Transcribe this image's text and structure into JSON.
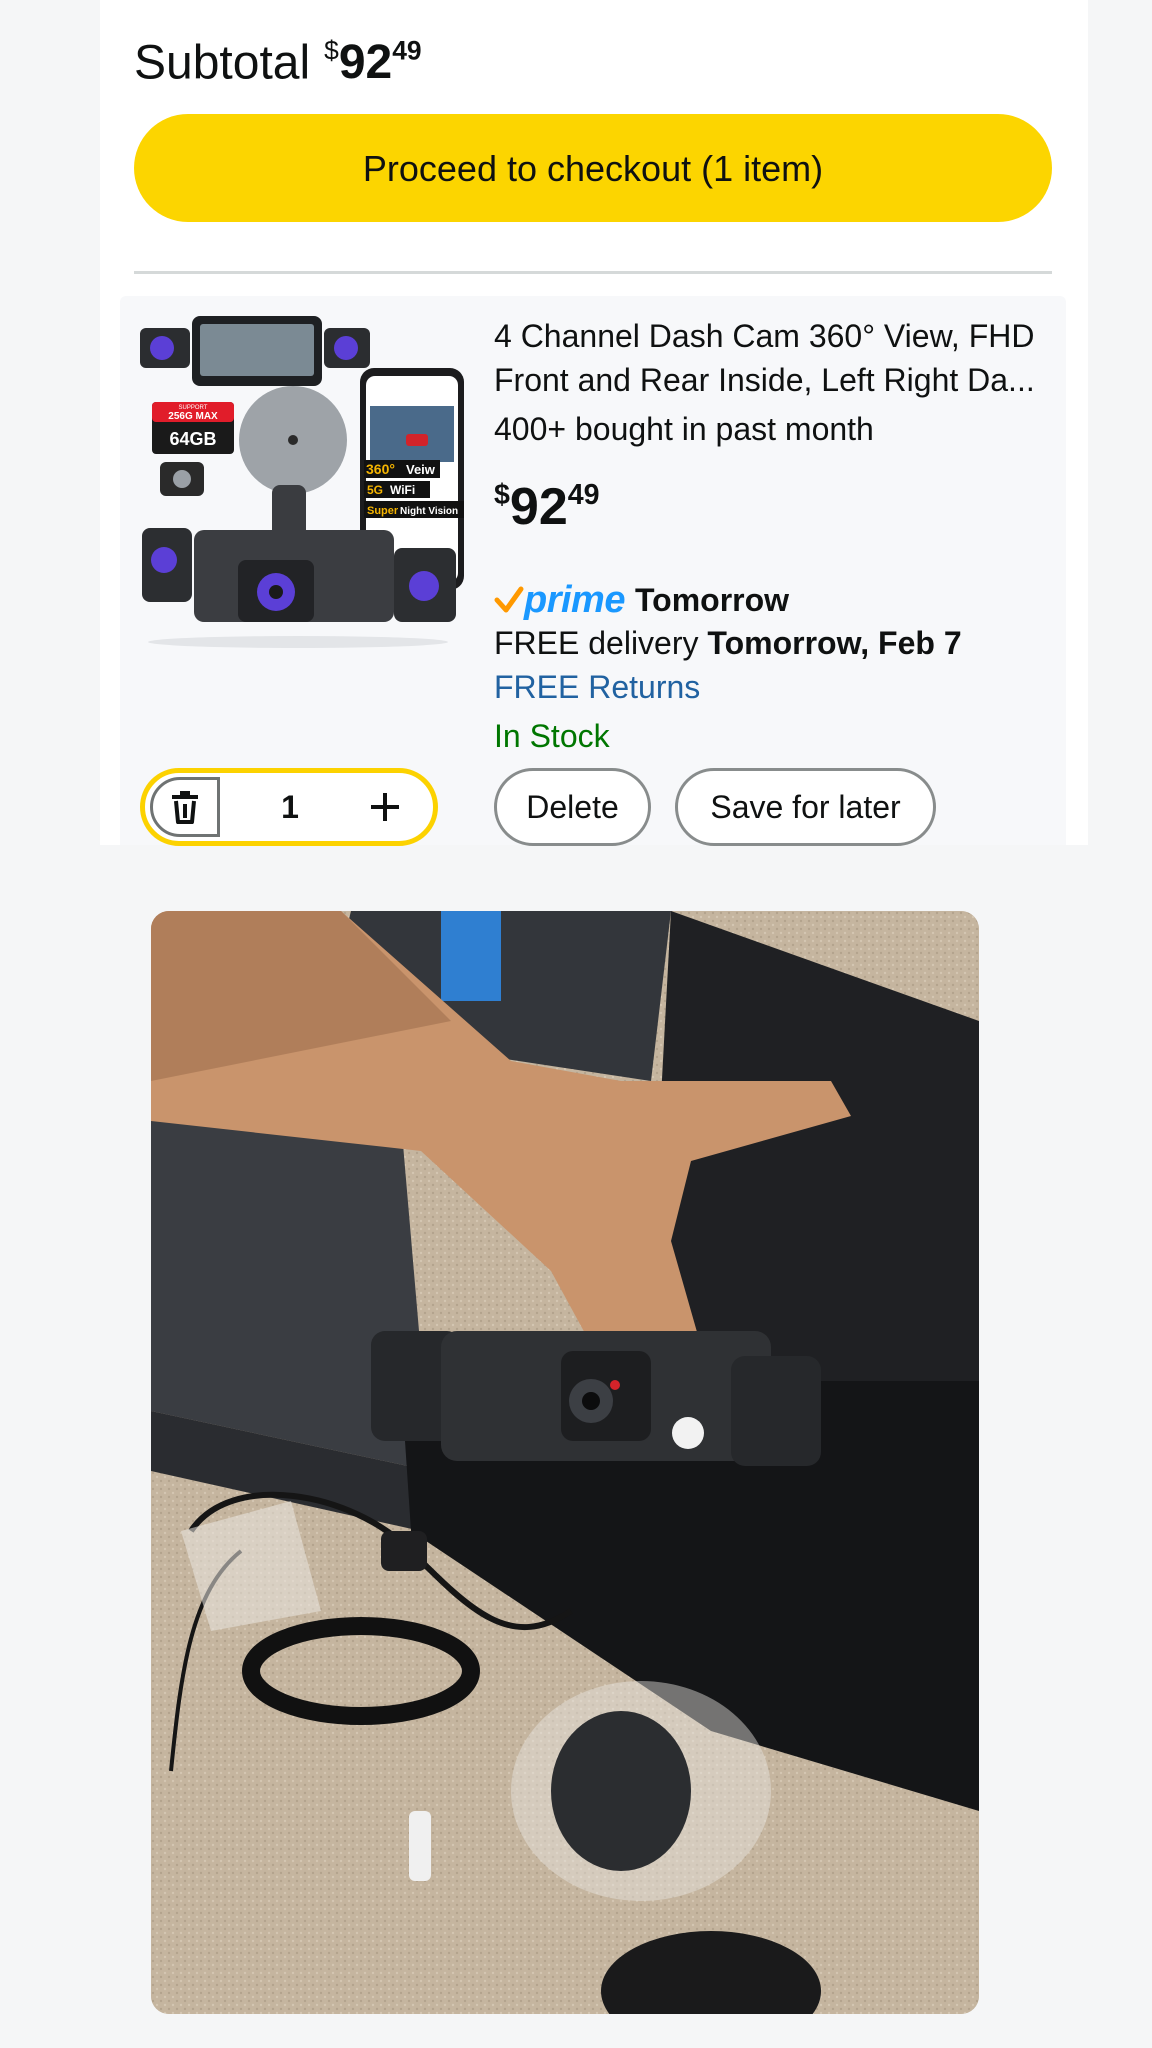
{
  "cart": {
    "subtotal_label": "Subtotal",
    "subtotal_currency": "$",
    "subtotal_whole": "92",
    "subtotal_fraction": "49",
    "checkout_label": "Proceed to checkout (1 item)"
  },
  "item": {
    "title": "4 Channel Dash Cam 360° View, FHD Front and Rear Inside, Left Right Da...",
    "bought": "400+ bought in past month",
    "price_currency": "$",
    "price_whole": "92",
    "price_fraction": "49",
    "prime_word": "prime",
    "prime_when": "Tomorrow",
    "delivery_prefix": "FREE delivery ",
    "delivery_date": "Tomorrow, Feb 7",
    "returns": "FREE Returns",
    "stock": "In Stock",
    "quantity": "1",
    "delete_label": "Delete",
    "save_label": "Save for later",
    "thumb_badges": {
      "storage_top": "SUPPORT",
      "storage_max": "256G MAX",
      "storage_size": "64GB",
      "view": "360°",
      "view_text": "Veiw",
      "wifi_band": "5G",
      "wifi_text": "WiFi",
      "night_super": "Super",
      "night_text": "Night Vision"
    }
  },
  "colors": {
    "checkout_yellow": "#fcd500",
    "qty_border": "#fcd200",
    "prime_blue": "#1a98ff",
    "prime_check": "#ff9900",
    "returns_link": "#2162a1",
    "stock_green": "#007600"
  },
  "icons": {
    "trash": "trash-icon",
    "plus": "plus-icon",
    "prime_check": "prime-check-icon"
  }
}
